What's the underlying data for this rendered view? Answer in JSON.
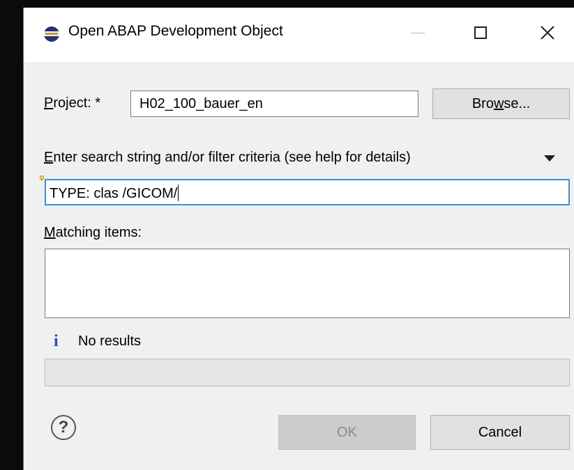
{
  "window": {
    "title": "Open ABAP Development Object",
    "app_icon": "eclipse-icon",
    "controls": [
      "minimize-icon",
      "maximize-icon",
      "close-icon"
    ]
  },
  "project": {
    "label_mnemonic": "P",
    "label_rest": "roject: *",
    "value": "H02_100_bauer_en",
    "browse_pre": "Bro",
    "browse_mnemonic": "w",
    "browse_post": "se..."
  },
  "search": {
    "label_mnemonic": "E",
    "label_rest": "nter search string and/or filter criteria (see help for details)",
    "value": "TYPE: clas /GICOM/",
    "menu_icon": "chevron-down-icon",
    "decorator_icon": "content-assist-bulb-icon"
  },
  "matching": {
    "label_mnemonic": "M",
    "label_rest": "atching items:",
    "items": []
  },
  "status": {
    "icon": "info-icon",
    "icon_glyph": "i",
    "text": "No results"
  },
  "footer": {
    "help_icon": "help-icon",
    "help_glyph": "?",
    "ok_label": "OK",
    "cancel_label": "Cancel"
  },
  "colors": {
    "focus_border": "#3d8fd7",
    "info_icon": "#1f4fbf",
    "disabled_button": "#cccccc"
  }
}
